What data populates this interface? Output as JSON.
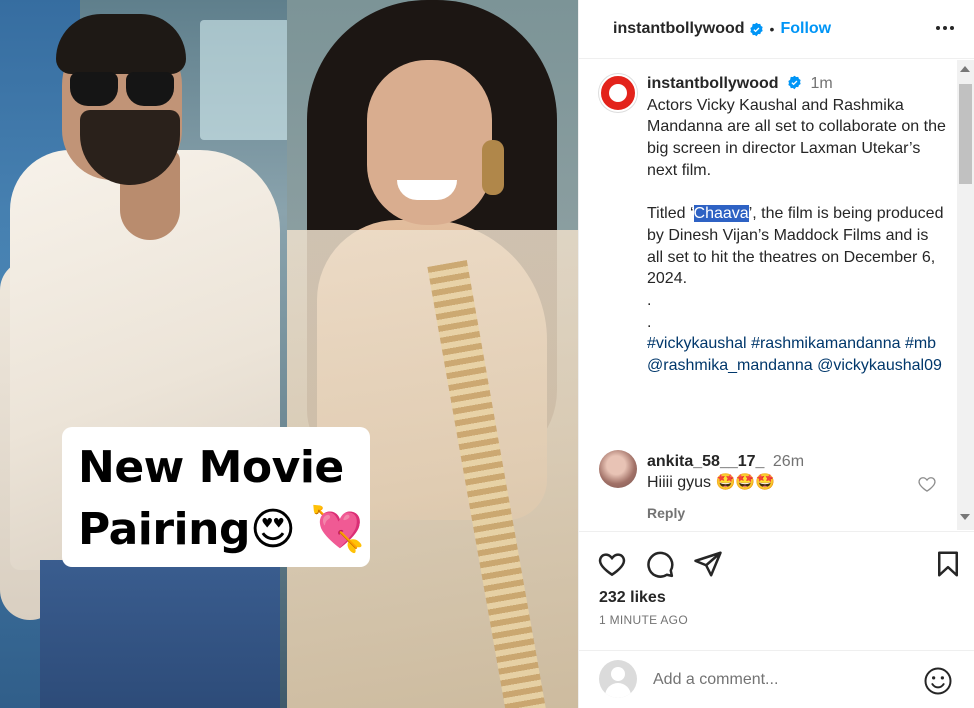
{
  "media": {
    "caption_line1": "New Movie",
    "caption_line2": "Pairing😍 💘"
  },
  "header": {
    "username": "instantbollywood",
    "separator": "•",
    "follow_label": "Follow"
  },
  "post": {
    "username": "instantbollywood",
    "time": "1m",
    "para1": "Actors Vicky Kaushal and Rashmika Mandanna are all set to collaborate on the big screen in director Laxman Utekar’s next film.",
    "para2_before": "Titled ‘",
    "para2_highlight": "Chaava",
    "para2_after": "’, the film is being produced by Dinesh Vijan’s Maddock Films and is all set to hit the theatres on December 6, 2024.",
    "dot1": ".",
    "dot2": ".",
    "tags": [
      "#vickykaushal",
      "#rashmikamandanna",
      "#mb",
      "@rashmika_mandanna",
      "@vickykaushal09"
    ]
  },
  "comment": {
    "username": "ankita_58__17_",
    "time": "26m",
    "text": "Hiiii gyus 🤩🤩🤩",
    "reply_label": "Reply"
  },
  "footer": {
    "likes": "232 likes",
    "posted_ago": "1 MINUTE AGO",
    "comment_placeholder": "Add a comment..."
  },
  "colors": {
    "accent": "#0095f6",
    "verified": "#0095f6",
    "hashtag": "#00376b",
    "selection": "#2e62c4"
  }
}
